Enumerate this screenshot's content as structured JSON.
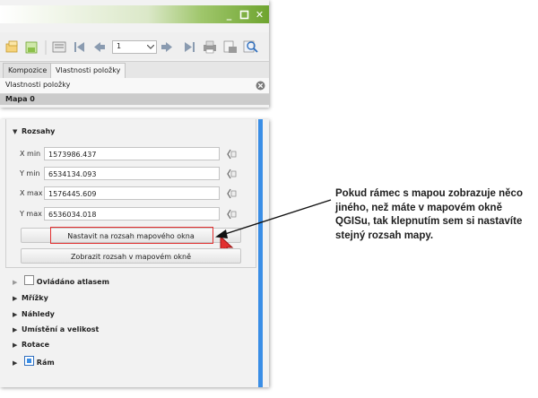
{
  "window": {
    "buttons": [
      "minimize",
      "restore",
      "close"
    ],
    "titlebar_color": "#7ab43a",
    "minimize_glyph": "_",
    "close_glyph": "✕"
  },
  "toolbar": {
    "page_value": "1",
    "icons": [
      "layer-icon",
      "layer-green-icon",
      "composer-icon",
      "first-page-icon",
      "prev-page-icon",
      "next-page-icon",
      "last-page-icon",
      "print-icon",
      "export-icon",
      "zoom-icon"
    ]
  },
  "tabs": [
    {
      "label": "Kompozice",
      "active": false
    },
    {
      "label": "Vlastnosti položky",
      "active": true
    }
  ],
  "panel": {
    "header": "Vlastnosti položky",
    "section": "Mapa 0"
  },
  "rozsahy": {
    "title": "Rozsahy",
    "fields": [
      {
        "label": "X min",
        "value": "1573986.437"
      },
      {
        "label": "Y min",
        "value": "6534134.093"
      },
      {
        "label": "X max",
        "value": "1576445.609"
      },
      {
        "label": "Y max",
        "value": "6536034.018"
      }
    ],
    "set_button": "Nastavit na rozsah mapového okna",
    "view_button": "Zobrazit rozsah v mapovém okně"
  },
  "sections": [
    {
      "label": "Ovládáno atlasem",
      "checkbox": true,
      "checked": false
    },
    {
      "label": "Mřížky",
      "checkbox": false
    },
    {
      "label": "Náhledy",
      "checkbox": false
    },
    {
      "label": "Umístění a velikost",
      "checkbox": false
    },
    {
      "label": "Rotace",
      "checkbox": false
    },
    {
      "label": "Rám",
      "checkbox": true,
      "checked": true
    }
  ],
  "annotation": {
    "text": "Pokud rámec s mapou zobrazuje něco jiného, než máte v mapovém okně QGISu, tak klepnutím sem si nastavíte stejný rozsah mapy."
  },
  "colors": {
    "accent_blue": "#3a8ee6",
    "highlight_red": "#e23030",
    "titlebar_green": "#7ab43a"
  }
}
